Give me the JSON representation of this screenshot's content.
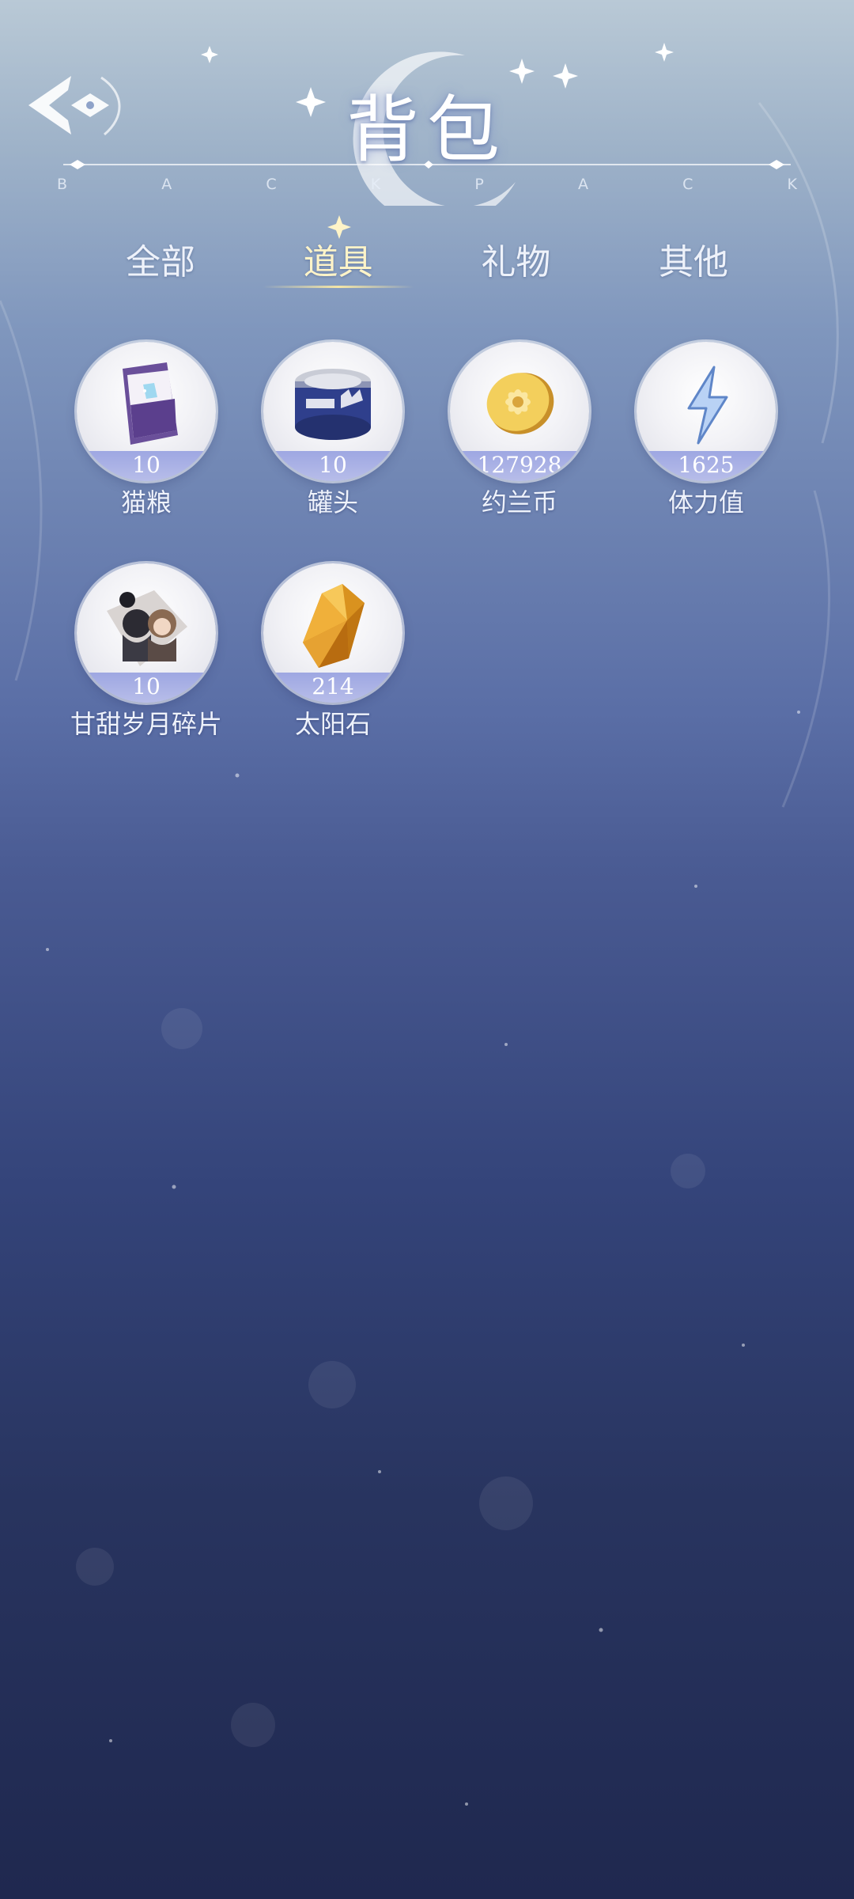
{
  "header": {
    "title": "背包",
    "subtitle_letters": [
      "B",
      "A",
      "C",
      "K",
      "P",
      "A",
      "C",
      "K"
    ]
  },
  "tabs": [
    {
      "label": "全部",
      "active": false
    },
    {
      "label": "道具",
      "active": true
    },
    {
      "label": "礼物",
      "active": false
    },
    {
      "label": "其他",
      "active": false
    }
  ],
  "items": [
    {
      "name": "猫粮",
      "count": "10",
      "icon": "cat-food-bag-icon"
    },
    {
      "name": "罐头",
      "count": "10",
      "icon": "canned-food-icon"
    },
    {
      "name": "约兰币",
      "count": "127928",
      "icon": "gold-coin-icon"
    },
    {
      "name": "体力值",
      "count": "1625",
      "icon": "lightning-icon"
    },
    {
      "name": "甘甜岁月碎片",
      "count": "10",
      "icon": "photo-fragment-icon"
    },
    {
      "name": "太阳石",
      "count": "214",
      "icon": "sun-crystal-icon"
    }
  ],
  "colors": {
    "active_tab": "#fff4c8",
    "count_band": "#a9b0e6",
    "background_top": "#b9c9d6",
    "background_bottom": "#1f284f"
  }
}
